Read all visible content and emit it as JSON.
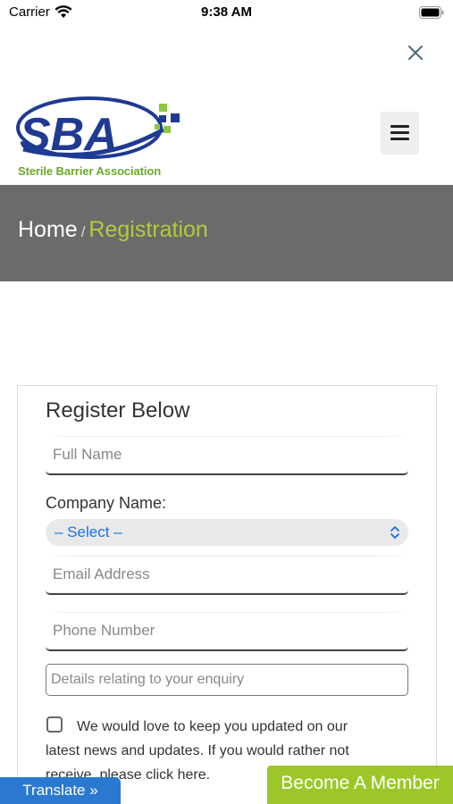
{
  "status_bar": {
    "carrier": "Carrier",
    "time": "9:38 AM"
  },
  "header": {
    "logo_text": "SBA",
    "logo_subtitle": "Sterile Barrier Association",
    "close_icon": "close-icon",
    "menu_icon": "hamburger-icon"
  },
  "breadcrumb": {
    "home": "Home",
    "separator": "/",
    "current": "Registration"
  },
  "form": {
    "title": "Register Below",
    "full_name_placeholder": "Full Name",
    "company_label": "Company Name:",
    "company_select_value": "– Select –",
    "email_placeholder": "Email Address",
    "phone_placeholder": "Phone Number",
    "details_placeholder": "Details relating to your enquiry",
    "consent_text": "We would love to keep you updated on our latest news and updates. If you would rather not receive, please click here."
  },
  "footer": {
    "translate_label": "Translate »",
    "member_label": "Become A Member"
  },
  "colors": {
    "brand_navy": "#1f3a93",
    "brand_green": "#8dc63f",
    "banner_gray": "#6b6b6b",
    "breadcrumb_current": "#b2cc3a",
    "translate_blue": "#2b78d0",
    "member_green": "#9dc728"
  }
}
